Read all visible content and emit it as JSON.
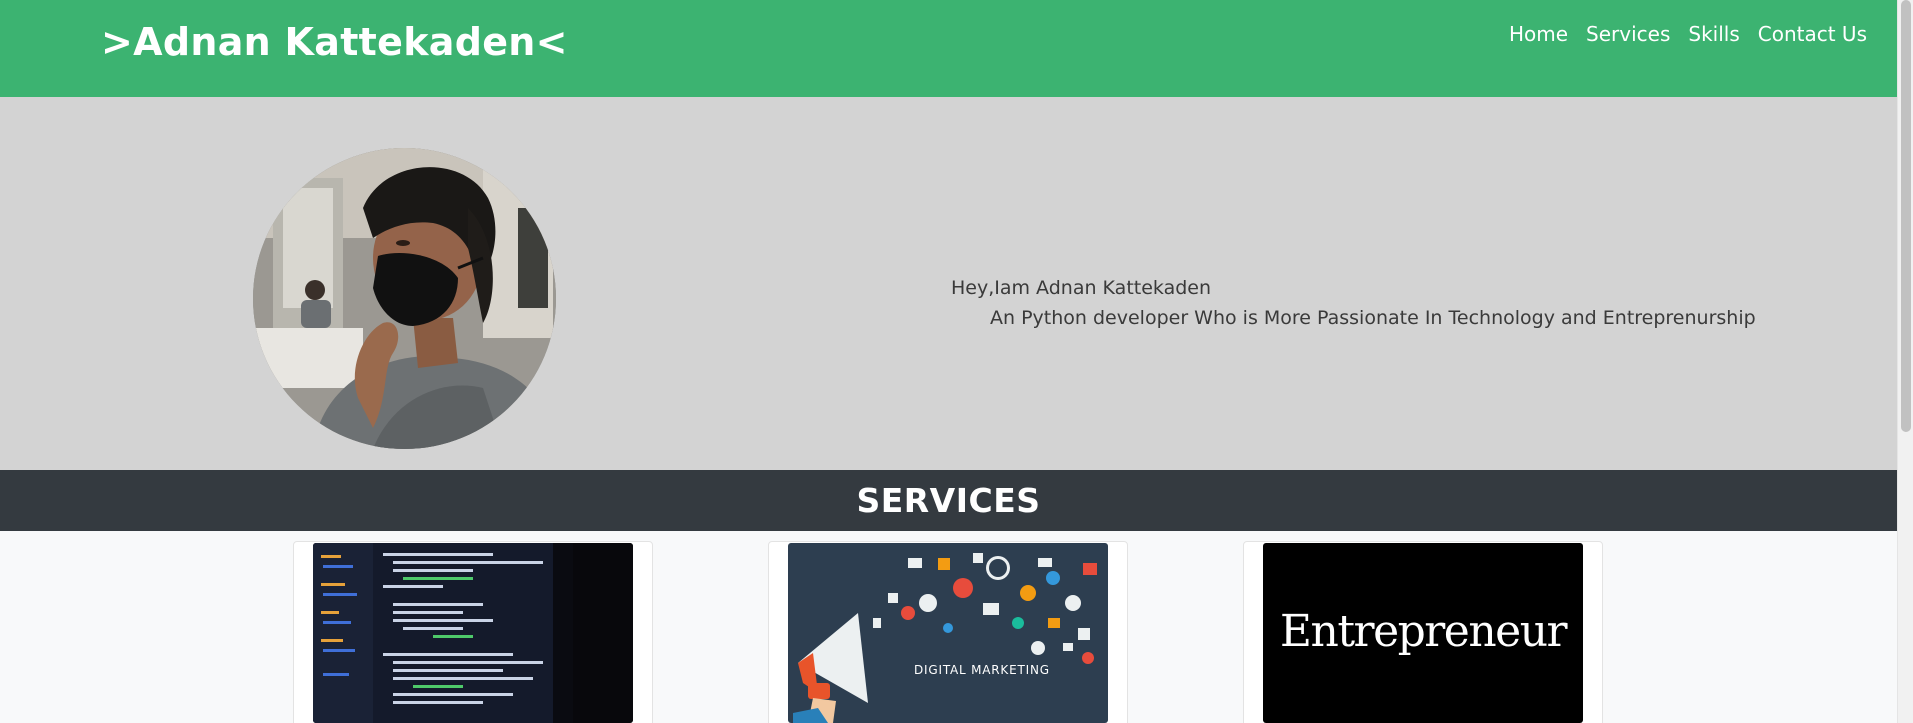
{
  "header": {
    "brand": ">Adnan Kattekaden<",
    "nav": [
      "Home",
      "Services",
      "Skills",
      "Contact Us"
    ]
  },
  "hero": {
    "greeting": "Hey,Iam Adnan Kattekaden",
    "tagline": "An Python developer Who is More Passionate In Technology and Entreprenurship"
  },
  "services": {
    "title": "SERVICES",
    "cards": [
      {
        "image": "code-on-laptop-image"
      },
      {
        "image": "digital-marketing-image",
        "image_text": "DIGITAL MARKETING"
      },
      {
        "image": "entrepreneur-logo-image",
        "image_text": "Entrepreneur"
      }
    ]
  },
  "colors": {
    "header_bg": "#3cb371",
    "hero_bg": "#d3d3d3",
    "services_bar_bg": "#343a40",
    "page_bg": "#f8f9fa"
  }
}
